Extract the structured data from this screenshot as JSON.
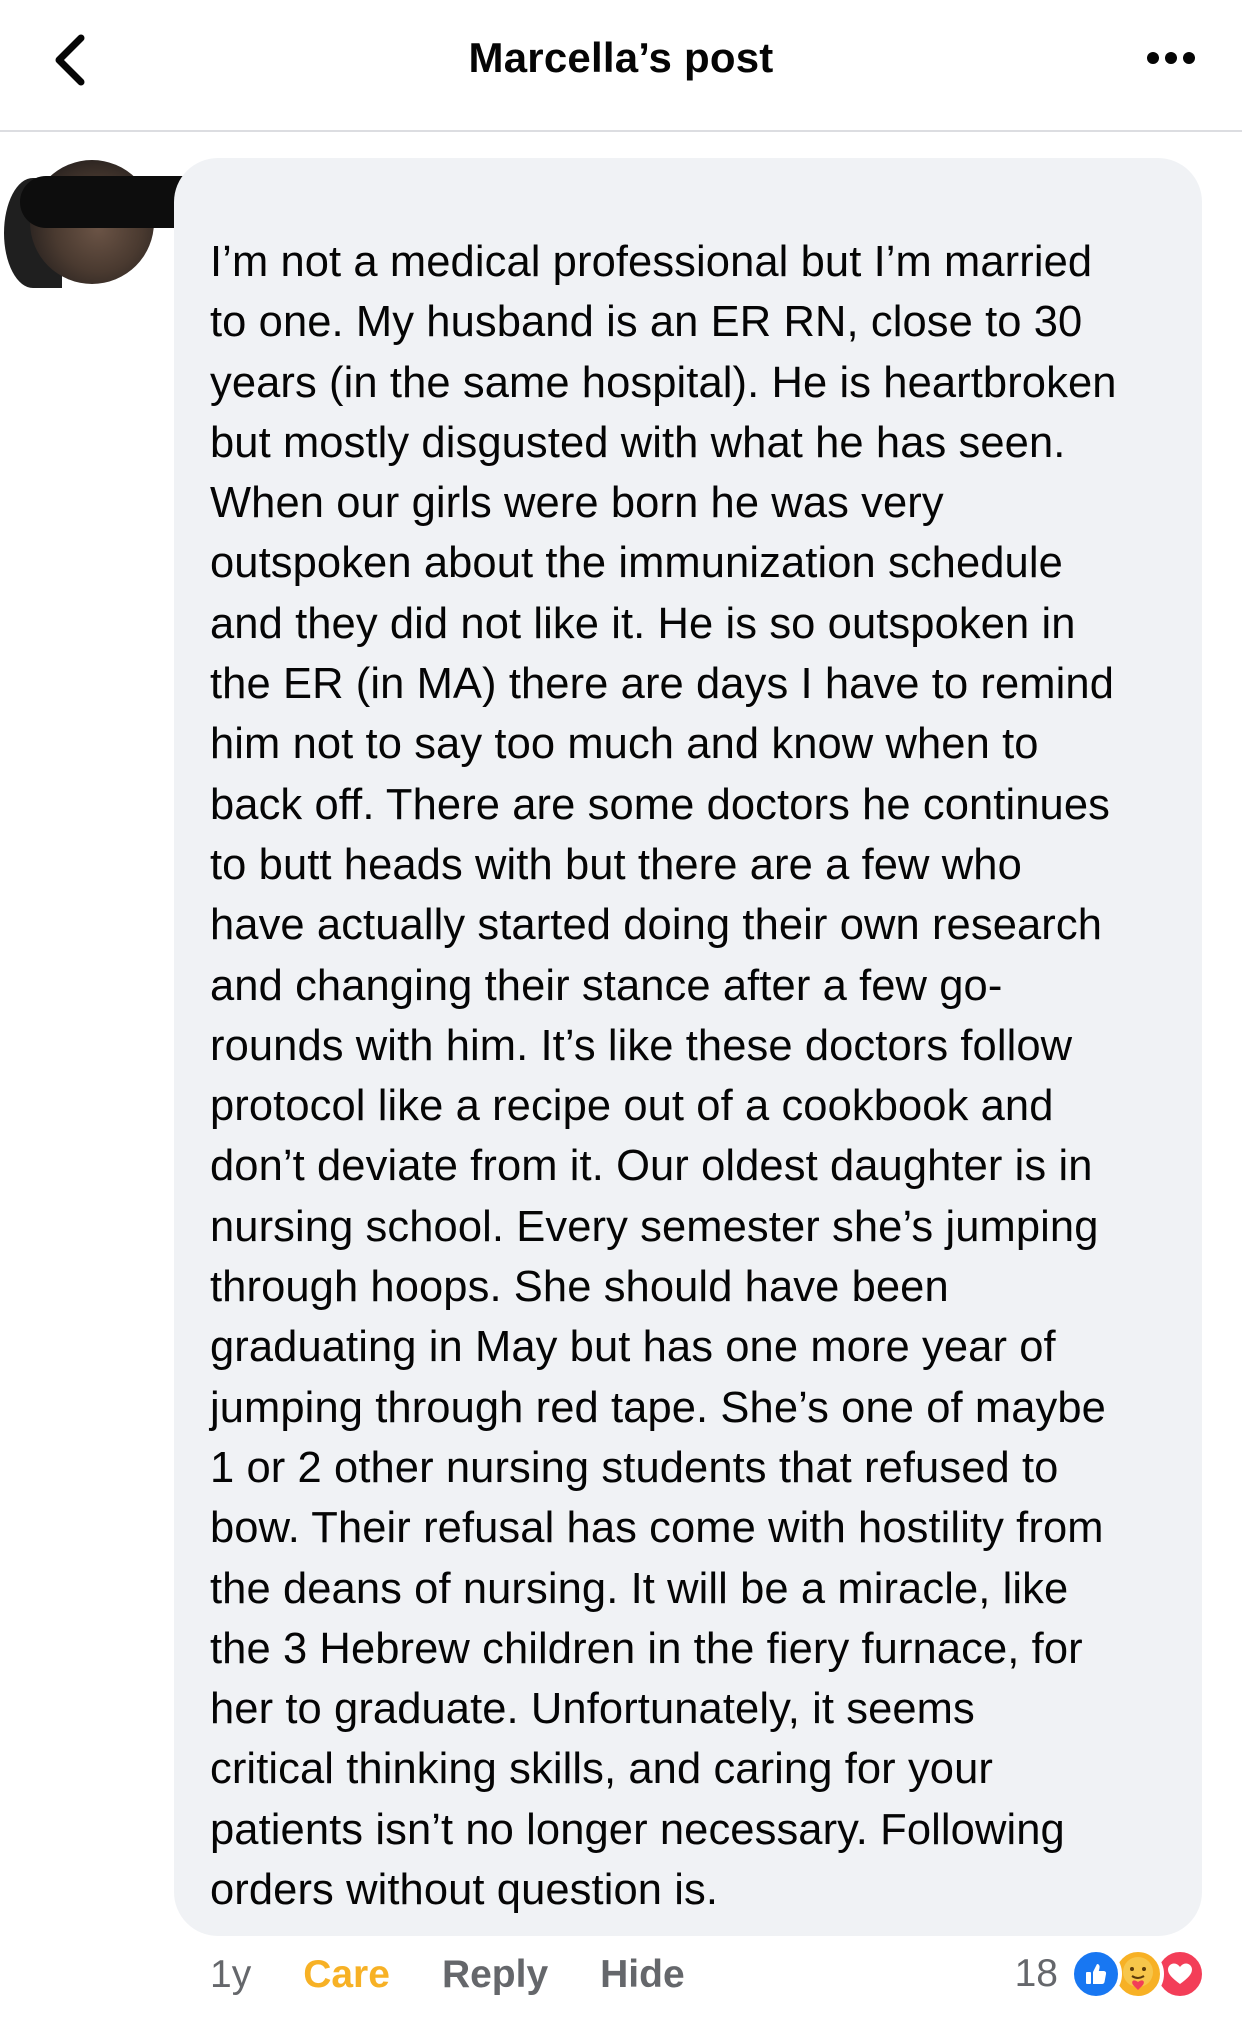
{
  "header": {
    "title": "Marcella’s post"
  },
  "comment": {
    "text": "I’m not a medical professional but I’m married\nto one. My husband is an ER RN, close to 30\nyears (in the same hospital). He is heartbroken\nbut mostly disgusted with what he has seen.\nWhen our girls were born he was very\noutspoken about the immunization schedule\nand they did not like it. He is so outspoken in\nthe ER (in MA) there are days I have to remind\nhim not to say too much and know when to\nback off. There are some doctors he continues\nto butt heads with but there are a few who\nhave actually started doing their own research\nand changing their stance after a few go-\nrounds with him.  It’s like these doctors follow\nprotocol like a recipe out of a cookbook and\ndon’t deviate from it. Our oldest daughter is in\nnursing school. Every semester she’s jumping\nthrough hoops. She should have been\ngraduating in May but has one more year of\njumping through red tape. She’s one of maybe\n1 or 2 other nursing students that refused to\nbow. Their refusal has come with hostility from\nthe deans of nursing. It will be a miracle, like\nthe 3 Hebrew children in the fiery furnace, for\nher to graduate. Unfortunately, it seems\ncritical thinking skills, and caring for your\npatients isn’t no longer necessary. Following\norders without question is."
  },
  "actions": {
    "time": "1y",
    "care": "Care",
    "reply": "Reply",
    "hide": "Hide"
  },
  "reactions": {
    "count": "18",
    "icons": [
      "like-icon",
      "care-icon",
      "love-icon"
    ]
  },
  "colors": {
    "bubble_bg": "#f0f2f5",
    "care_accent": "#f7b125",
    "like_blue": "#1877f2",
    "love_red": "#f33e58",
    "secondary_text": "#65676b"
  }
}
